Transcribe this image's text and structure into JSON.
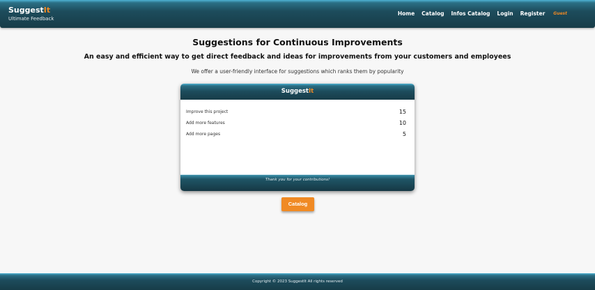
{
  "navbar": {
    "brand_main": "Suggest",
    "brand_accent": "It",
    "brand_sub": "Ultimate Feedback",
    "links": [
      "Home",
      "Catalog",
      "Infos Catalog",
      "Login",
      "Register"
    ],
    "user_status": "Guest"
  },
  "main": {
    "title": "Suggestions for Continuous Improvements",
    "subtitle": "An easy and efficient way to get direct feedback and ideas for improvements from your customers and employees",
    "description": "We offer a user-friendly interface for suggestions which ranks them by popularity"
  },
  "card": {
    "title_main": "Suggest",
    "title_accent": "It",
    "items": [
      {
        "label": "Improve this project",
        "count": "15"
      },
      {
        "label": "Add more features",
        "count": "10"
      },
      {
        "label": "Add more pages",
        "count": "5"
      }
    ],
    "footer_text": "Thank you for your contributions!"
  },
  "catalog_button": "Catalog",
  "footer": {
    "text": "Copyright © 2023 SuggestIt    All rights reserved"
  },
  "colors": {
    "accent": "#f08a24",
    "header_dark": "#173c48",
    "header_light": "#4fb3d3",
    "background": "#f7f7f7"
  }
}
